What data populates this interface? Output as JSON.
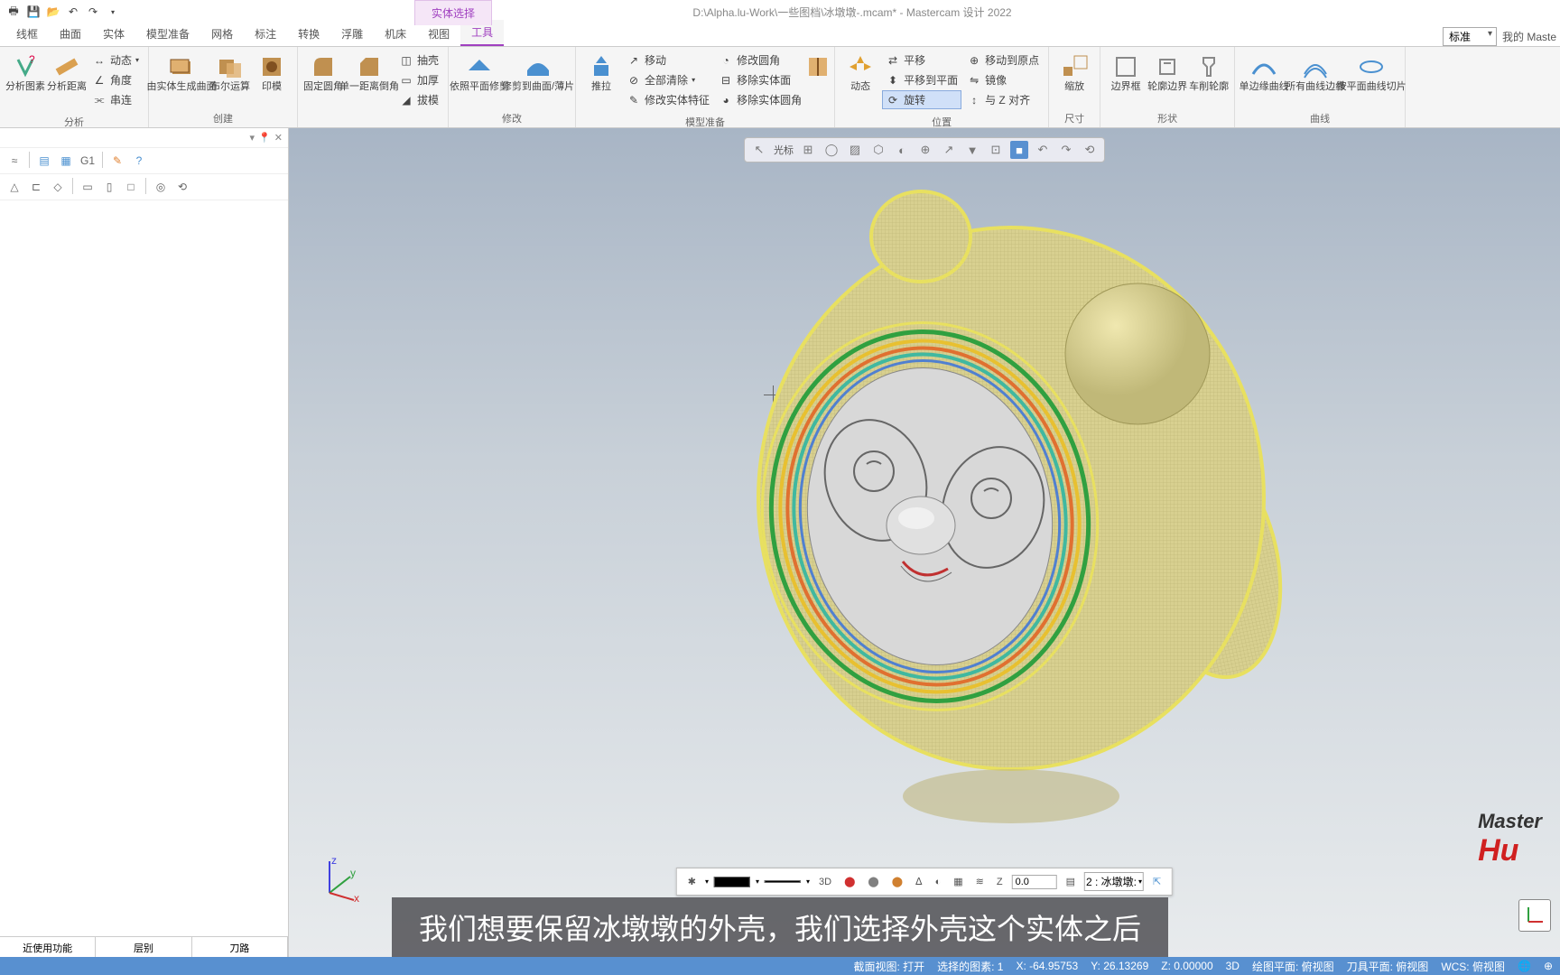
{
  "title": "D:\\Alpha.lu-Work\\一些图档\\冰墩墩-.mcam* - Mastercam 设计 2022",
  "context_tab": "实体选择",
  "tabs": [
    "线框",
    "曲面",
    "实体",
    "模型准备",
    "网格",
    "标注",
    "转换",
    "浮雕",
    "机床",
    "视图",
    "工具"
  ],
  "active_tab_index": 10,
  "ribbon_right": {
    "combo": "标准",
    "mine": "我的 Maste"
  },
  "groups": {
    "analyze": {
      "label": "分析",
      "items": [
        "分析图素",
        "分析距离"
      ],
      "small": [
        "动态",
        "角度",
        "串连"
      ]
    },
    "create": {
      "label": "创建",
      "items": [
        "由实体生成曲面",
        "布尔运算",
        "印模"
      ]
    },
    "unnamed1": {
      "items": [
        "固定圆角",
        "单一距离倒角"
      ],
      "small": [
        "抽壳",
        "加厚",
        "拔模"
      ]
    },
    "modify": {
      "label": "修改",
      "items": [
        "依照平面修剪",
        "修剪到曲面/薄片"
      ]
    },
    "modelprep": {
      "label": "模型准备",
      "items": [
        "推拉"
      ],
      "small1": [
        "移动",
        "全部清除",
        "修改实体特征"
      ],
      "small2": [
        "修改圆角",
        "移除实体面",
        "移除实体圆角"
      ]
    },
    "position": {
      "label": "位置",
      "items": [
        "动态"
      ],
      "small1": [
        "平移",
        "平移到平面",
        "旋转"
      ],
      "small2": [
        "移动到原点",
        "镜像",
        "与 Z 对齐"
      ]
    },
    "size": {
      "label": "尺寸",
      "items": [
        "缩放"
      ]
    },
    "shape": {
      "label": "形状",
      "items": [
        "边界框",
        "轮廓边界",
        "车削轮廓"
      ]
    },
    "curves": {
      "label": "曲线",
      "items": [
        "单边缘曲线",
        "所有曲线边缘",
        "按平面曲线切片"
      ]
    }
  },
  "panel": {
    "tabs": [
      "近使用功能",
      "层别",
      "刀路"
    ]
  },
  "sel_toolbar_label": "光标",
  "bottom_toolbar": {
    "mode3d": "3D",
    "z_label": "Z",
    "z_val": "0.0",
    "layer": "2 : 冰墩墩:"
  },
  "watermark": {
    "l1": "Master",
    "l2": "Hu"
  },
  "subtitle": "我们想要保留冰墩墩的外壳，我们选择外壳这个实体之后",
  "status": {
    "view": "截面视图: 打开",
    "selected": "选择的图素: 1",
    "x": "X: -64.95753",
    "y": "Y: 26.13269",
    "z": "Z: 0.00000",
    "mode": "3D",
    "plane": "绘图平面: 俯视图",
    "tool": "刀具平面: 俯视图",
    "wcs": "WCS: 俯视图"
  },
  "axis_labels": {
    "x": "x",
    "y": "y",
    "z": "z"
  }
}
